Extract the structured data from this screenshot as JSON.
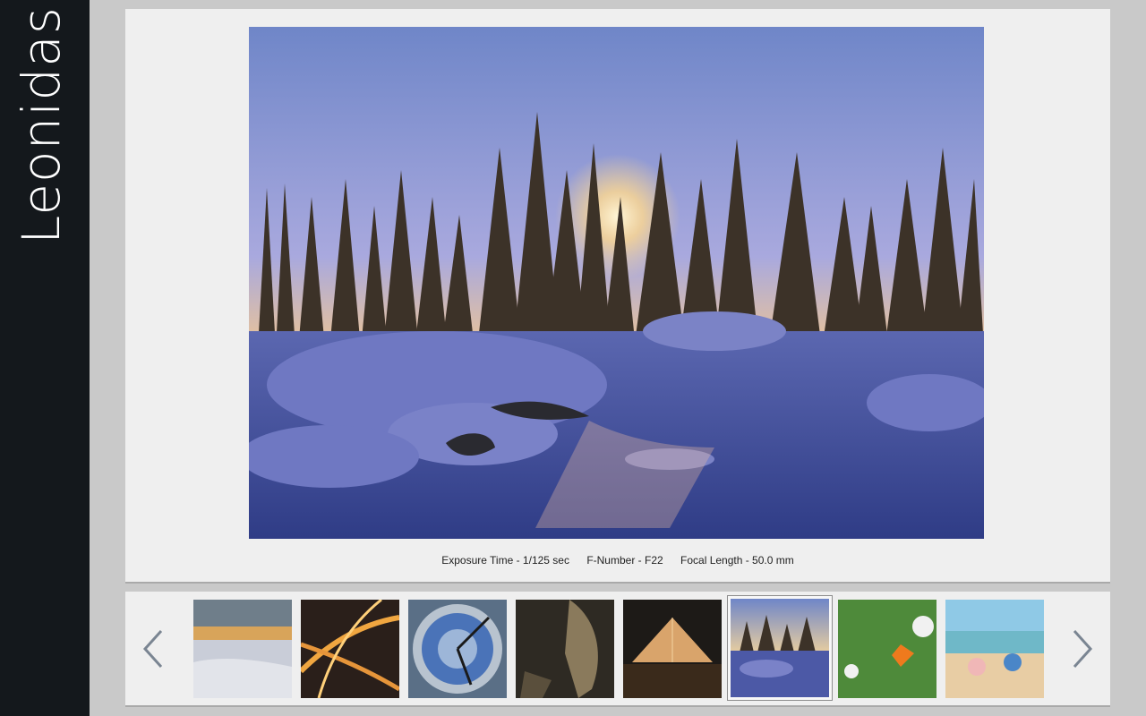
{
  "app": {
    "logo_text": "Leonidas",
    "accent_color": "#e0772a",
    "sidebar_color": "#14181c"
  },
  "photo": {
    "subject": "snowy forest sunset",
    "exif": {
      "exposure": "Exposure Time - 1/125 sec",
      "fnumber": "F-Number - F22",
      "focal": "Focal Length - 50.0 mm"
    }
  },
  "gallery": {
    "prev_icon": "chevron-left-icon",
    "next_icon": "chevron-right-icon",
    "thumbnails": [
      {
        "subject": "sunset over frozen sea",
        "selected": false
      },
      {
        "subject": "city highway interchange at night",
        "selected": false
      },
      {
        "subject": "astronomical clock",
        "selected": false
      },
      {
        "subject": "dinosaur skeleton",
        "selected": false
      },
      {
        "subject": "glass pyramid at night",
        "selected": false
      },
      {
        "subject": "snowy forest sunset",
        "selected": true
      },
      {
        "subject": "orange butterfly on flowers",
        "selected": false
      },
      {
        "subject": "children on beach",
        "selected": false
      }
    ]
  }
}
